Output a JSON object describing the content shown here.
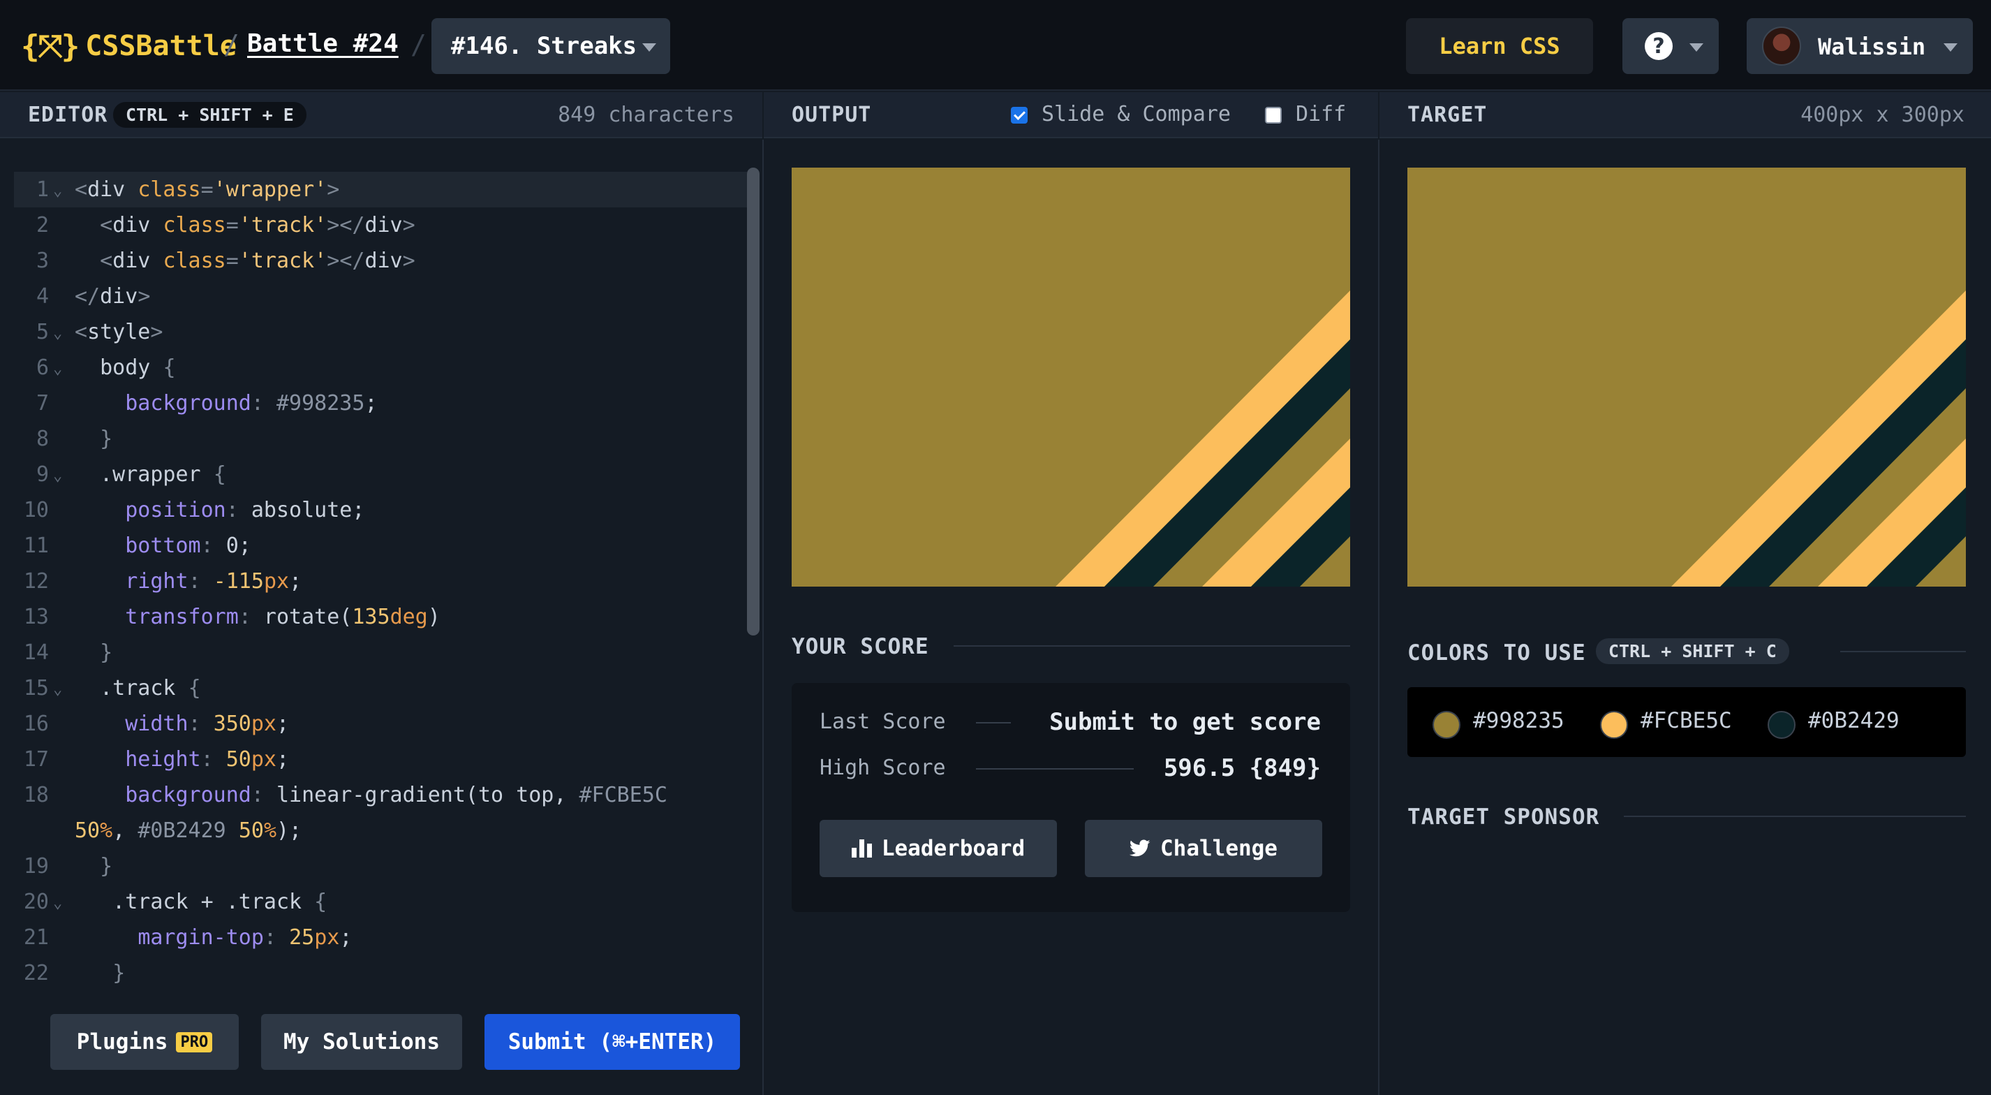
{
  "header": {
    "logo_text": "CSSBattle",
    "breadcrumb_sep": "/",
    "battle_label": "Battle #24",
    "challenge_label": "#146. Streaks",
    "learn_label": "Learn CSS",
    "help_glyph": "?",
    "user_name": "Walissin"
  },
  "editor": {
    "title": "EDITOR",
    "shortcut": "CTRL + SHIFT + E",
    "char_count": "849 characters",
    "plugins_label": "Plugins",
    "pro_badge": "PRO",
    "solutions_label": "My Solutions",
    "submit_label": "Submit (⌘+ENTER)"
  },
  "output": {
    "title": "OUTPUT",
    "slide_compare_label": "Slide & Compare",
    "slide_compare_checked": true,
    "diff_label": "Diff",
    "diff_checked": false
  },
  "target": {
    "title": "TARGET",
    "size": "400px x 300px"
  },
  "score": {
    "title": "YOUR SCORE",
    "last_label": "Last Score",
    "last_value": "Submit to get score",
    "high_label": "High Score",
    "high_value": "596.5 {849}",
    "leaderboard_label": "Leaderboard",
    "challenge_label": "Challenge"
  },
  "colors": {
    "title": "COLORS TO USE",
    "shortcut": "CTRL + SHIFT + C",
    "items": [
      {
        "hex": "#998235"
      },
      {
        "hex": "#FCBE5C"
      },
      {
        "hex": "#0B2429"
      }
    ]
  },
  "sponsor": {
    "title": "TARGET SPONSOR"
  },
  "code_lines": [
    {
      "n": "1",
      "fold": true,
      "text": "<div class='wrapper'>"
    },
    {
      "n": "2",
      "fold": false,
      "text": "  <div class='track'></div>"
    },
    {
      "n": "3",
      "fold": false,
      "text": "  <div class='track'></div>"
    },
    {
      "n": "4",
      "fold": false,
      "text": "</div>"
    },
    {
      "n": "5",
      "fold": true,
      "text": "<style>"
    },
    {
      "n": "6",
      "fold": true,
      "text": "  body {"
    },
    {
      "n": "7",
      "fold": false,
      "text": "    background: #998235;"
    },
    {
      "n": "8",
      "fold": false,
      "text": "  }"
    },
    {
      "n": "9",
      "fold": true,
      "text": "  .wrapper {"
    },
    {
      "n": "10",
      "fold": false,
      "text": "    position: absolute;"
    },
    {
      "n": "11",
      "fold": false,
      "text": "    bottom: 0;"
    },
    {
      "n": "12",
      "fold": false,
      "text": "    right: -115px;"
    },
    {
      "n": "13",
      "fold": false,
      "text": "    transform: rotate(135deg)"
    },
    {
      "n": "14",
      "fold": false,
      "text": "  }"
    },
    {
      "n": "15",
      "fold": true,
      "text": "  .track {"
    },
    {
      "n": "16",
      "fold": false,
      "text": "    width: 350px;"
    },
    {
      "n": "17",
      "fold": false,
      "text": "    height: 50px;"
    },
    {
      "n": "18",
      "fold": false,
      "text": "    background: linear-gradient(to top, #FCBE5C"
    },
    {
      "n": "",
      "fold": false,
      "text": "50%, #0B2429 50%);"
    },
    {
      "n": "19",
      "fold": false,
      "text": "  }"
    },
    {
      "n": "20",
      "fold": true,
      "text": "   .track + .track {"
    },
    {
      "n": "21",
      "fold": false,
      "text": "     margin-top: 25px;"
    },
    {
      "n": "22",
      "fold": false,
      "text": "   }"
    }
  ],
  "theme": {
    "accent": "#f7cd45",
    "submit": "#1a56db",
    "bg": "#998235",
    "stripe_light": "#FCBE5C",
    "stripe_dark": "#0B2429"
  }
}
